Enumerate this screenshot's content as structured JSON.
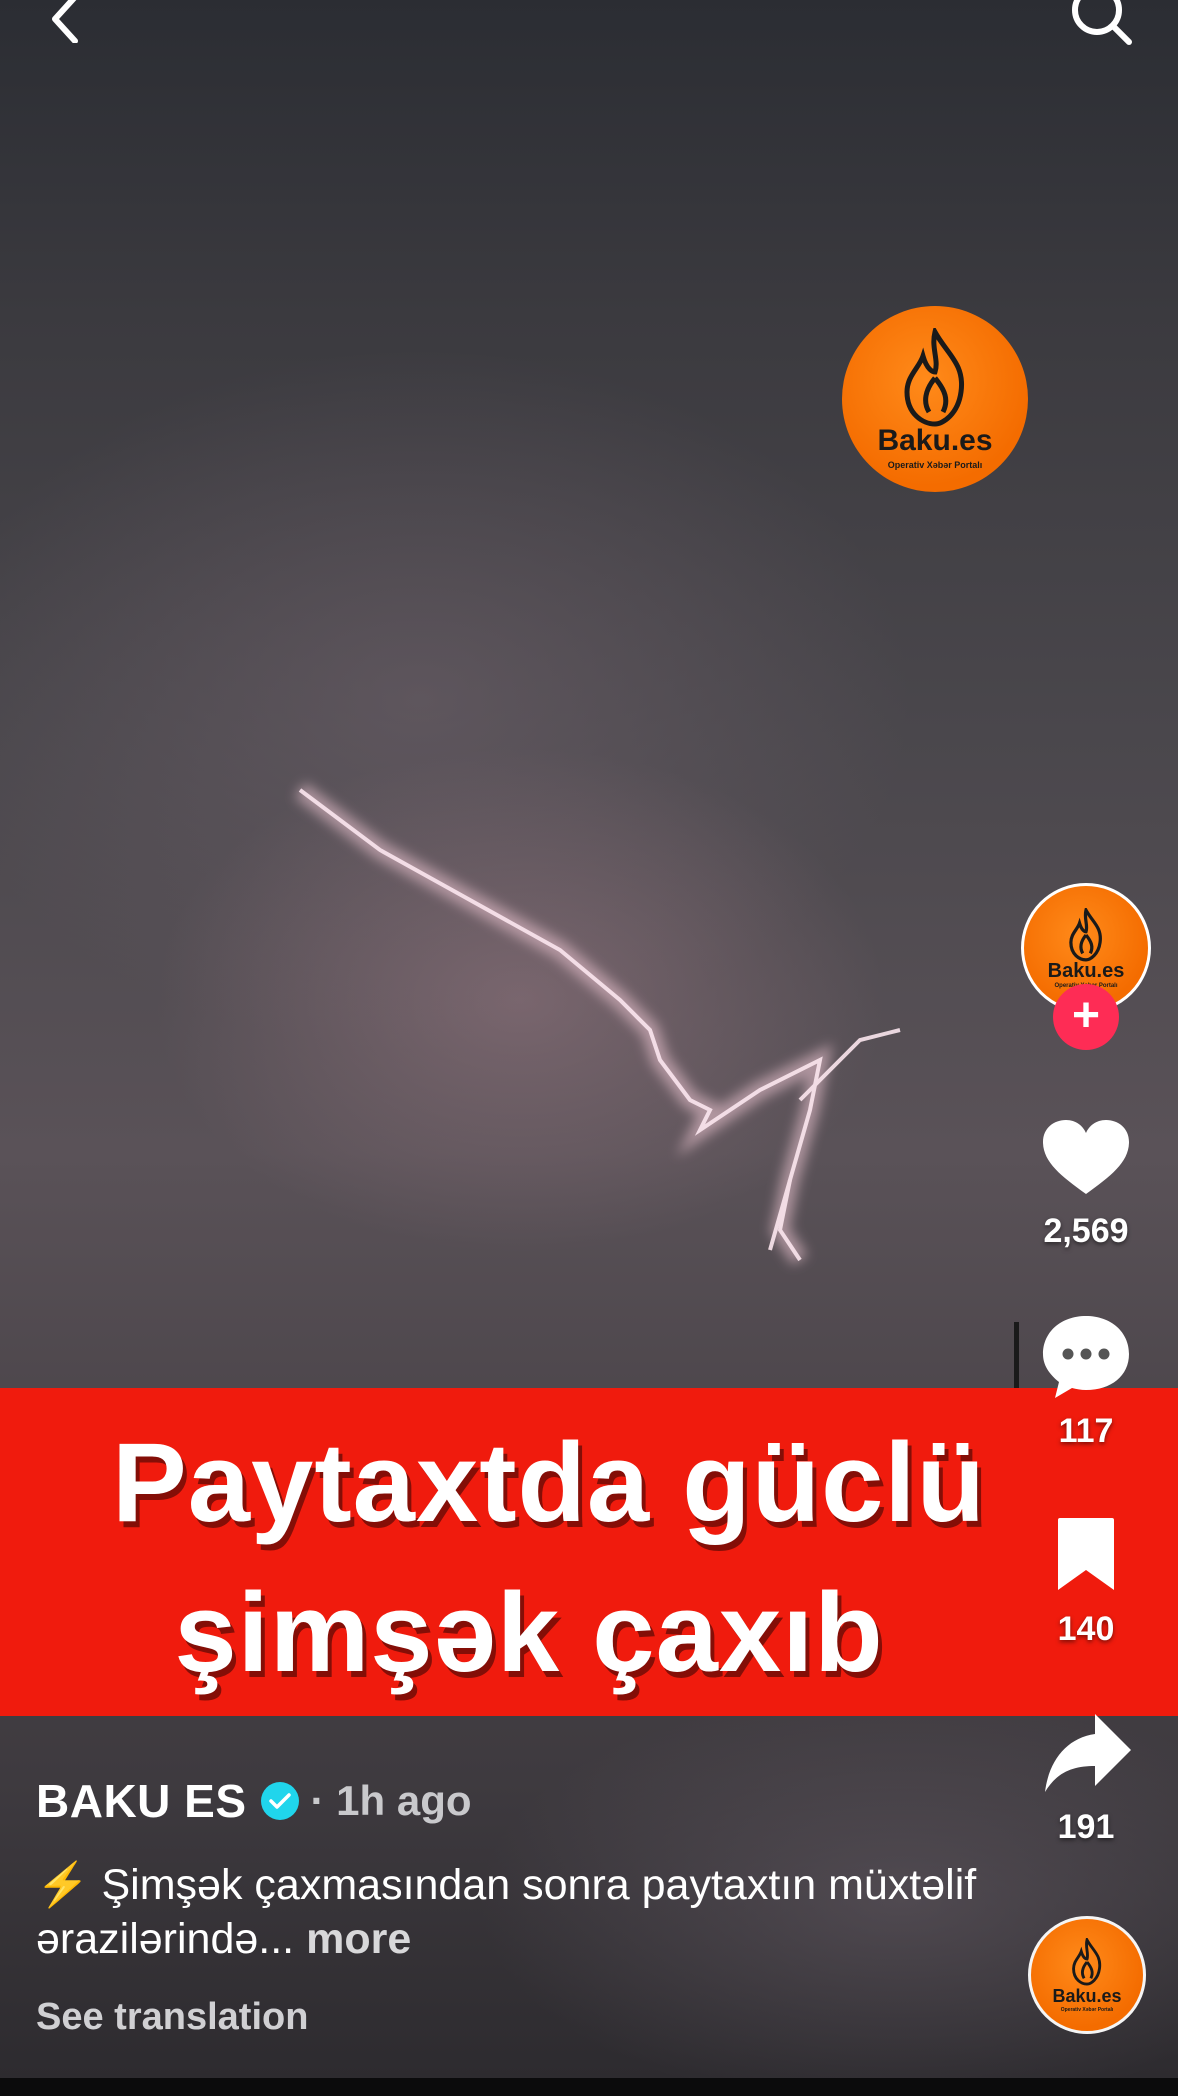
{
  "banner": {
    "line1": "Paytaxtda güclü",
    "line2": "şimşək çaxıb"
  },
  "watermark": {
    "brand": "Baku.es",
    "tagline": "Operativ Xəbər Portalı"
  },
  "actions": {
    "likes": "2,569",
    "comments": "117",
    "saves": "140",
    "shares": "191"
  },
  "post": {
    "author": "BAKU ES",
    "time": "· 1h ago",
    "caption_emoji": "⚡",
    "caption_text": "Şimşək çaxmasından sonra paytaxtın müxtəlif ərazilərində...",
    "caption_more": "more",
    "see_translation": "See translation"
  },
  "colors": {
    "banner": "#f01b0d",
    "logo_orange": "#f46c00",
    "follow": "#fe2c55",
    "verified": "#20d5ec"
  },
  "icons": [
    "back-icon",
    "search-icon",
    "heart-icon",
    "comment-icon",
    "bookmark-icon",
    "share-icon",
    "plus-icon",
    "verified-icon",
    "lightning-icon"
  ]
}
